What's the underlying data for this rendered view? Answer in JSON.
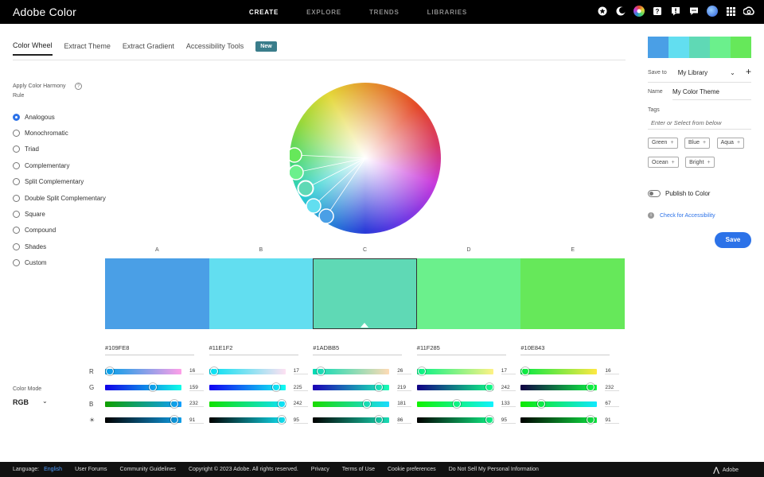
{
  "app": {
    "title": "Adobe Color"
  },
  "topnav": [
    "CREATE",
    "EXPLORE",
    "TRENDS",
    "LIBRARIES"
  ],
  "topicons": [
    "star-icon",
    "moon-icon",
    "color-wheel-icon",
    "help-icon",
    "alert-icon",
    "chat-icon",
    "avatar",
    "apps-grid-icon",
    "creative-cloud-icon"
  ],
  "tabs": [
    "Color Wheel",
    "Extract Theme",
    "Extract Gradient",
    "Accessibility Tools"
  ],
  "tab_badge": "New",
  "harmony": {
    "title": "Apply Color Harmony Rule",
    "rules": [
      "Analogous",
      "Monochromatic",
      "Triad",
      "Complementary",
      "Split Complementary",
      "Double Split Complementary",
      "Square",
      "Compound",
      "Shades",
      "Custom"
    ],
    "selected": "Analogous"
  },
  "swatch_letters": [
    "A",
    "B",
    "C",
    "D",
    "E"
  ],
  "swatches": [
    {
      "hex": "#109FE8",
      "color": "#4a9fe6",
      "r": 16,
      "g": 159,
      "b": 232,
      "br": 91
    },
    {
      "hex": "#11E1F2",
      "color": "#62def0",
      "r": 17,
      "g": 225,
      "b": 242,
      "br": 95
    },
    {
      "hex": "#1ADBB5",
      "color": "#5fd9b5",
      "r": 26,
      "g": 219,
      "b": 181,
      "br": 86
    },
    {
      "hex": "#11F285",
      "color": "#6bf08c",
      "r": 17,
      "g": 242,
      "b": 133,
      "br": 95
    },
    {
      "hex": "#10E843",
      "color": "#66e85a",
      "r": 16,
      "g": 232,
      "b": 67,
      "br": 91
    }
  ],
  "selected_swatch": 2,
  "channels": [
    "R",
    "G",
    "B",
    "☀"
  ],
  "color_mode": {
    "label": "Color Mode",
    "value": "RGB"
  },
  "right_panel": {
    "save_to_label": "Save to",
    "library": "My Library",
    "name_label": "Name",
    "name_value": "My Color Theme",
    "tags_label": "Tags",
    "tags_placeholder": "Enter or Select from below",
    "tags": [
      "Green",
      "Blue",
      "Aqua",
      "Ocean",
      "Bright"
    ],
    "publish_label": "Publish to Color",
    "accessibility_link": "Check for Accessibility",
    "save_button": "Save"
  },
  "footer": {
    "language_label": "Language:",
    "language": "English",
    "links": [
      "User Forums",
      "Community Guidelines",
      "Copyright © 2023 Adobe. All rights reserved.",
      "Privacy",
      "Terms of Use",
      "Cookie preferences",
      "Do Not Sell My Personal Information"
    ],
    "brand": "Adobe"
  }
}
